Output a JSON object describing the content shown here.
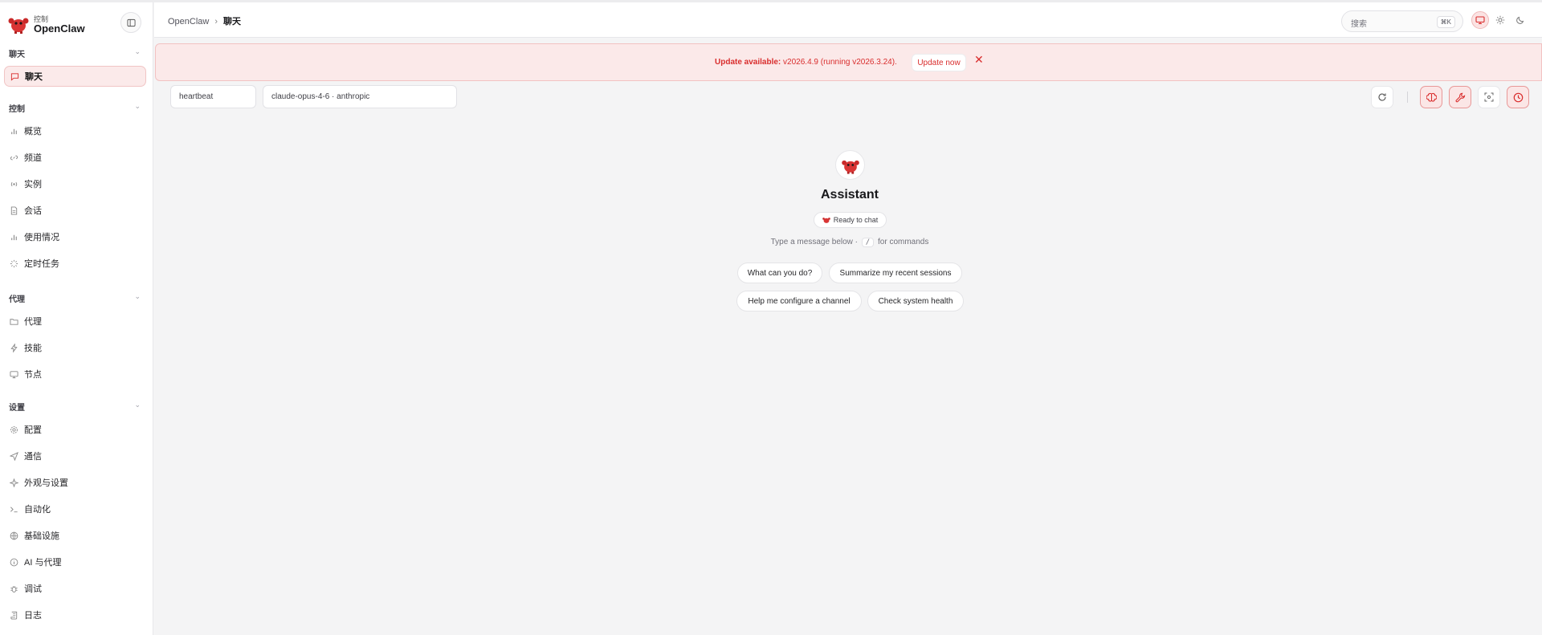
{
  "app": {
    "brand_sub": "控制",
    "brand_name": "OpenClaw"
  },
  "sidebar": {
    "groups": [
      {
        "label": "聊天",
        "items": [
          {
            "label": "聊天",
            "icon": "chat-bubble-icon",
            "active": true
          }
        ]
      },
      {
        "label": "控制",
        "items": [
          {
            "label": "概览",
            "icon": "bar-chart-icon"
          },
          {
            "label": "频道",
            "icon": "link-icon"
          },
          {
            "label": "实例",
            "icon": "radio-waves-icon"
          },
          {
            "label": "会话",
            "icon": "document-icon"
          },
          {
            "label": "使用情况",
            "icon": "bar-chart-icon"
          },
          {
            "label": "定时任务",
            "icon": "loader-icon"
          }
        ]
      },
      {
        "label": "代理",
        "items": [
          {
            "label": "代理",
            "icon": "folder-icon"
          },
          {
            "label": "技能",
            "icon": "lightning-icon"
          },
          {
            "label": "节点",
            "icon": "monitor-icon"
          }
        ]
      },
      {
        "label": "设置",
        "items": [
          {
            "label": "配置",
            "icon": "gear-icon"
          },
          {
            "label": "通信",
            "icon": "send-icon"
          },
          {
            "label": "外观与设置",
            "icon": "sparkle-icon"
          },
          {
            "label": "自动化",
            "icon": "terminal-icon"
          },
          {
            "label": "基础设施",
            "icon": "globe-icon"
          },
          {
            "label": "AI 与代理",
            "icon": "info-circle-icon"
          },
          {
            "label": "调试",
            "icon": "bug-icon"
          },
          {
            "label": "日志",
            "icon": "scroll-icon"
          }
        ]
      }
    ]
  },
  "header": {
    "breadcrumb_root": "OpenClaw",
    "breadcrumb_separator": "›",
    "breadcrumb_current": "聊天",
    "search_placeholder": "搜索",
    "search_shortcut": "⌘K",
    "theme_modes": [
      "monitor-icon",
      "sun-icon",
      "moon-icon"
    ],
    "active_theme": "monitor-icon"
  },
  "banner": {
    "strong": "Update available:",
    "message": " v2026.4.9 (running v2026.3.24).",
    "button": "Update now",
    "close": "✕"
  },
  "toolbar": {
    "session": "heartbeat",
    "model": "claude-opus-4-6 · anthropic"
  },
  "welcome": {
    "title": "Assistant",
    "status": "Ready to chat",
    "hint_before": "Type a message below ·",
    "hint_key": "/",
    "hint_after": "for commands",
    "suggestions": [
      "What can you do?",
      "Summarize my recent sessions",
      "Help me configure a channel",
      "Check system health"
    ]
  },
  "colors": {
    "accent": "#d92d2d",
    "active_bg": "#fbeaea"
  }
}
